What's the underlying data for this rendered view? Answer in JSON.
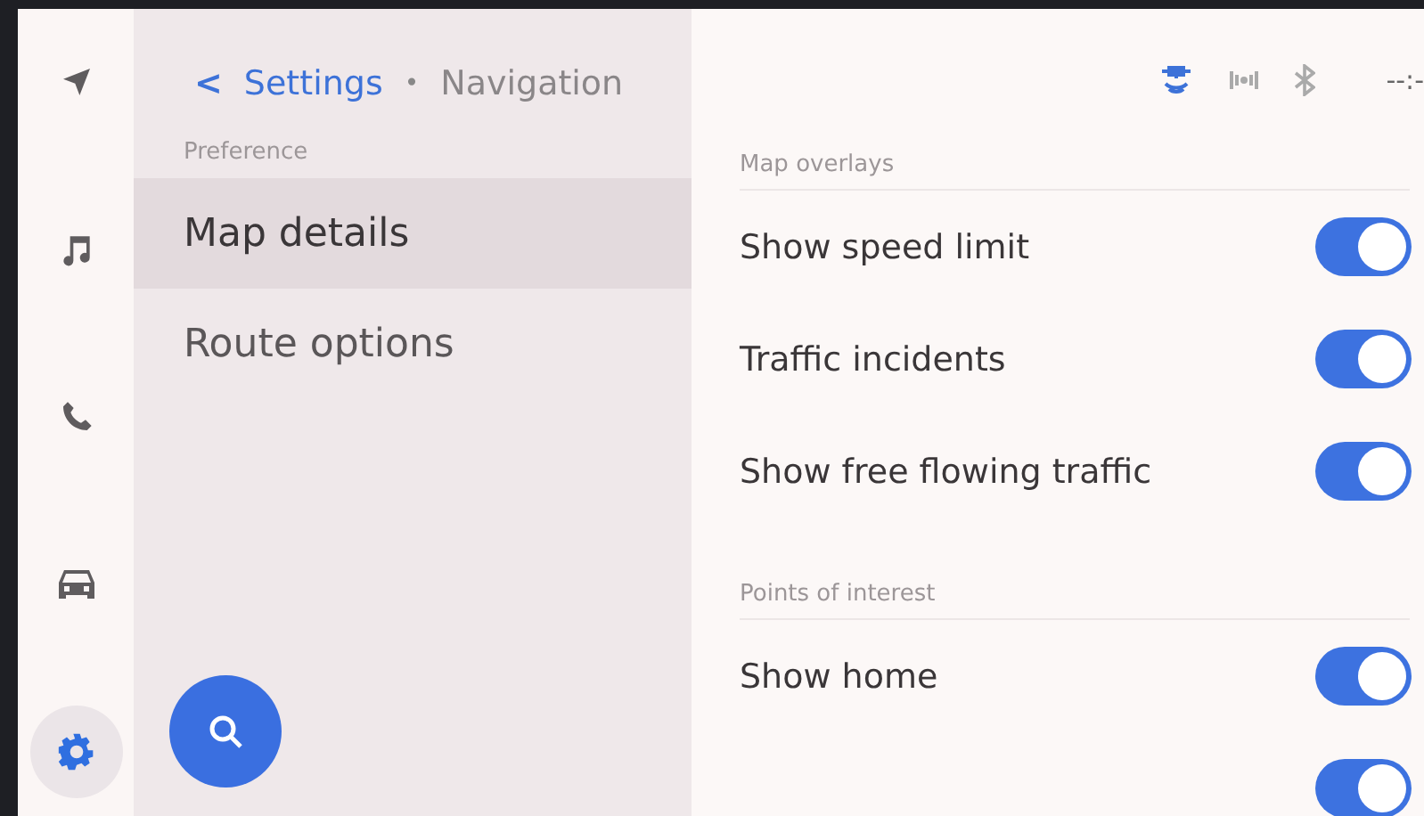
{
  "rail": [
    {
      "kind": "navigation",
      "selected": false
    },
    {
      "kind": "music",
      "selected": false
    },
    {
      "kind": "phone",
      "selected": false
    },
    {
      "kind": "car",
      "selected": false
    },
    {
      "kind": "settings",
      "selected": true
    }
  ],
  "breadcrumb": {
    "back": "<",
    "parent": "Settings",
    "separator": "•",
    "current": "Navigation"
  },
  "menu": {
    "section": "Preference",
    "items": [
      {
        "label": "Map details",
        "selected": true
      },
      {
        "label": "Route options",
        "selected": false
      }
    ]
  },
  "status_bar": {
    "icons": [
      {
        "kind": "satellite"
      },
      {
        "kind": "radio"
      },
      {
        "kind": "bluetooth"
      }
    ],
    "time": "--:-"
  },
  "sections": [
    {
      "title": "Map overlays",
      "toggles": [
        {
          "label": "Show speed limit",
          "on": true
        },
        {
          "label": "Traffic incidents",
          "on": true
        },
        {
          "label": "Show free flowing traffic",
          "on": true
        }
      ]
    },
    {
      "title": "Points of interest",
      "toggles": [
        {
          "label": "Show home",
          "on": true
        },
        {
          "on": true
        }
      ]
    }
  ]
}
